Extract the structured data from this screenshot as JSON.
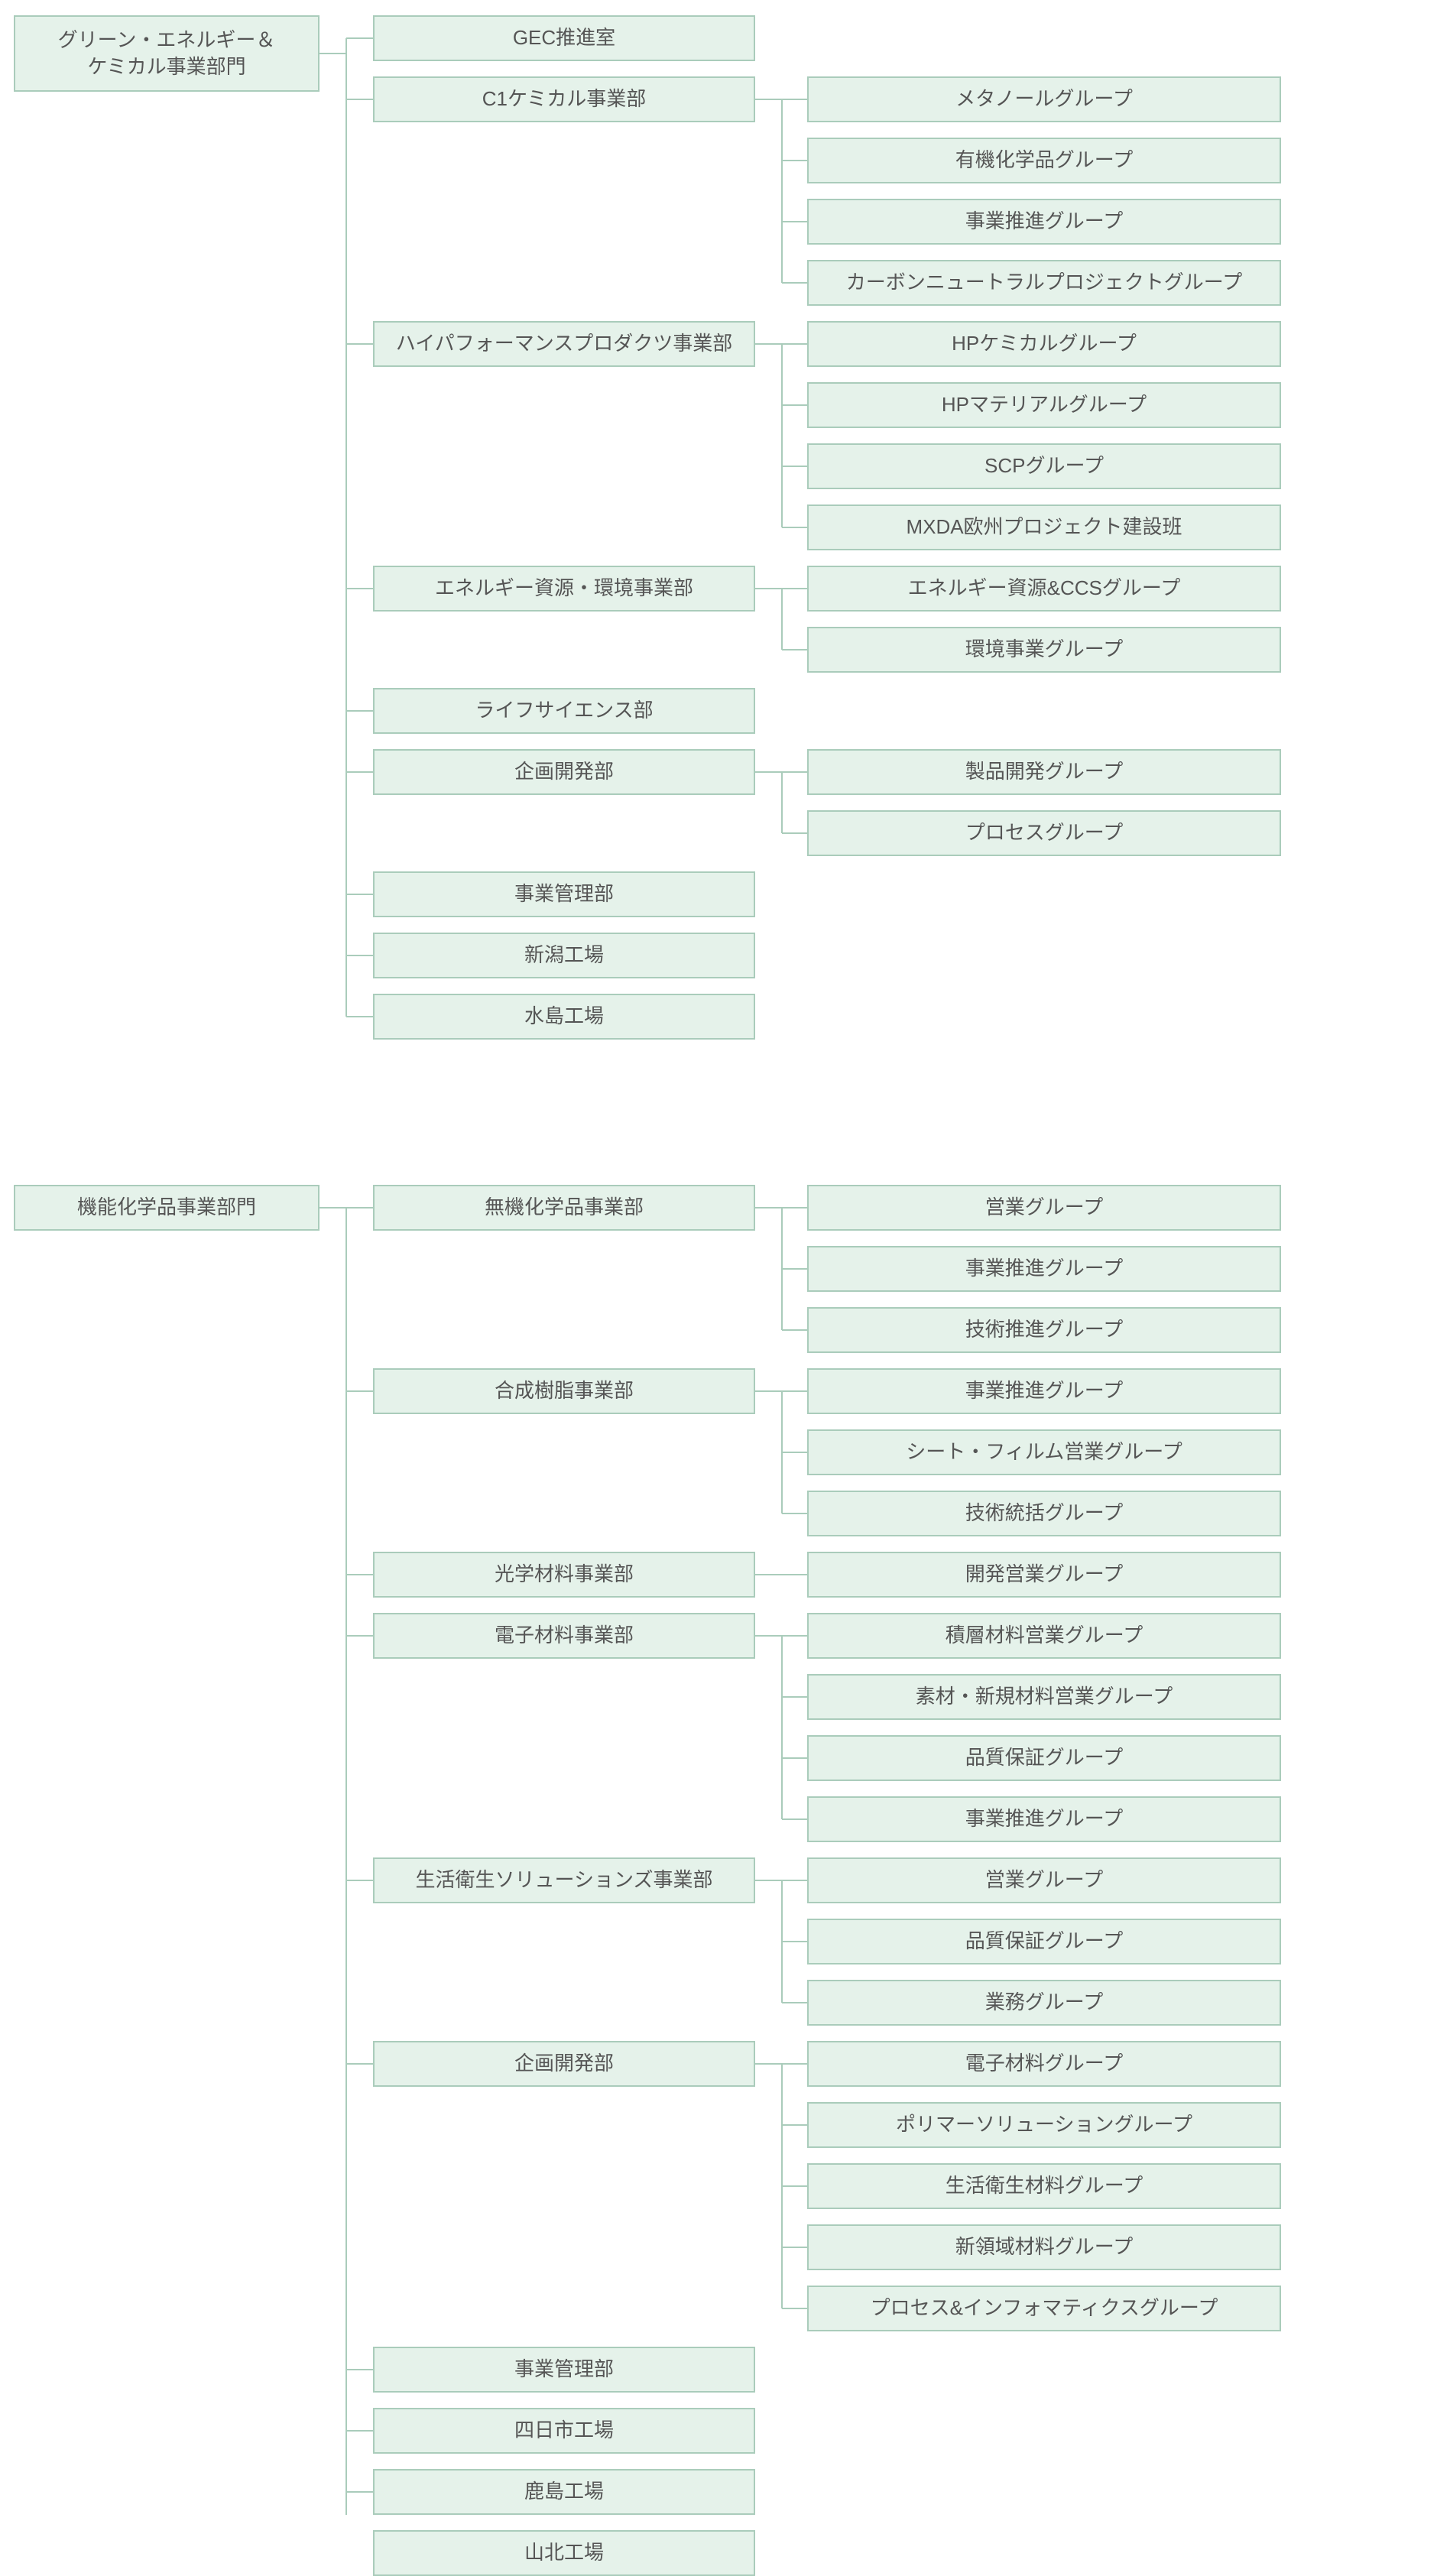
{
  "layout": {
    "rootLeft": 18,
    "rootWidth": 400,
    "rootHeight": 100,
    "rootHeightSingle": 60,
    "deptLeft": 488,
    "deptWidth": 500,
    "deptHeight": 60,
    "groupLeft": 1056,
    "groupWidth": 620,
    "groupHeight": 60,
    "vgap": 20,
    "sectionGap": 190
  },
  "sections": [
    {
      "id": "sector-green-energy-chemical",
      "label": "グリーン・エネルギー＆\nケミカル事業部門",
      "rootTop": 20,
      "rootHeightKey": "rootHeight",
      "departments": [
        {
          "id": "dept-gec-promotion",
          "label": "GEC推進室",
          "groups": []
        },
        {
          "id": "dept-c1-chemical",
          "label": "C1ケミカル事業部",
          "groups": [
            "メタノールグループ",
            "有機化学品グループ",
            "事業推進グループ",
            "カーボンニュートラルプロジェクトグループ"
          ]
        },
        {
          "id": "dept-high-performance-products",
          "label": "ハイパフォーマンスプロダクツ事業部",
          "groups": [
            "HPケミカルグループ",
            "HPマテリアルグループ",
            "SCPグループ",
            "MXDA欧州プロジェクト建設班"
          ]
        },
        {
          "id": "dept-energy-resources-env",
          "label": "エネルギー資源・環境事業部",
          "groups": [
            "エネルギー資源&CCSグループ",
            "環境事業グループ"
          ]
        },
        {
          "id": "dept-life-science",
          "label": "ライフサイエンス部",
          "groups": []
        },
        {
          "id": "dept-planning-dev-1",
          "label": "企画開発部",
          "groups": [
            "製品開発グループ",
            "プロセスグループ"
          ]
        },
        {
          "id": "dept-business-admin-1",
          "label": "事業管理部",
          "groups": []
        },
        {
          "id": "dept-niigata-plant",
          "label": "新潟工場",
          "groups": []
        },
        {
          "id": "dept-mizushima-plant",
          "label": "水島工場",
          "groups": []
        }
      ]
    },
    {
      "id": "sector-functional-chemicals",
      "label": "機能化学品事業部門",
      "rootHeightKey": "rootHeightSingle",
      "departments": [
        {
          "id": "dept-inorganic-chem",
          "label": "無機化学品事業部",
          "groups": [
            "営業グループ",
            "事業推進グループ",
            "技術推進グループ"
          ]
        },
        {
          "id": "dept-synthetic-resin",
          "label": "合成樹脂事業部",
          "groups": [
            "事業推進グループ",
            "シート・フィルム営業グループ",
            "技術統括グループ"
          ]
        },
        {
          "id": "dept-optical-materials",
          "label": "光学材料事業部",
          "groups": [
            "開発営業グループ"
          ]
        },
        {
          "id": "dept-electronic-materials",
          "label": "電子材料事業部",
          "groups": [
            "積層材料営業グループ",
            "素材・新規材料営業グループ",
            "品質保証グループ",
            "事業推進グループ"
          ]
        },
        {
          "id": "dept-hygiene-solutions",
          "label": "生活衛生ソリューションズ事業部",
          "groups": [
            "営業グループ",
            "品質保証グループ",
            "業務グループ"
          ]
        },
        {
          "id": "dept-planning-dev-2",
          "label": "企画開発部",
          "groups": [
            "電子材料グループ",
            "ポリマーソリューショングループ",
            "生活衛生材料グループ",
            "新領域材料グループ",
            "プロセス&インフォマティクスグループ"
          ]
        },
        {
          "id": "dept-business-admin-2",
          "label": "事業管理部",
          "groups": []
        },
        {
          "id": "dept-yokkaichi-plant",
          "label": "四日市工場",
          "groups": []
        },
        {
          "id": "dept-kashima-plant",
          "label": "鹿島工場",
          "groups": []
        },
        {
          "id": "dept-yamakita-plant",
          "label": "山北工場",
          "groups": []
        }
      ]
    }
  ],
  "chart_data": {
    "type": "tree",
    "title": "",
    "nodes": [
      {
        "name": "グリーン・エネルギー＆ケミカル事業部門",
        "children": [
          {
            "name": "GEC推進室"
          },
          {
            "name": "C1ケミカル事業部",
            "children": [
              {
                "name": "メタノールグループ"
              },
              {
                "name": "有機化学品グループ"
              },
              {
                "name": "事業推進グループ"
              },
              {
                "name": "カーボンニュートラルプロジェクトグループ"
              }
            ]
          },
          {
            "name": "ハイパフォーマンスプロダクツ事業部",
            "children": [
              {
                "name": "HPケミカルグループ"
              },
              {
                "name": "HPマテリアルグループ"
              },
              {
                "name": "SCPグループ"
              },
              {
                "name": "MXDA欧州プロジェクト建設班"
              }
            ]
          },
          {
            "name": "エネルギー資源・環境事業部",
            "children": [
              {
                "name": "エネルギー資源&CCSグループ"
              },
              {
                "name": "環境事業グループ"
              }
            ]
          },
          {
            "name": "ライフサイエンス部"
          },
          {
            "name": "企画開発部",
            "children": [
              {
                "name": "製品開発グループ"
              },
              {
                "name": "プロセスグループ"
              }
            ]
          },
          {
            "name": "事業管理部"
          },
          {
            "name": "新潟工場"
          },
          {
            "name": "水島工場"
          }
        ]
      },
      {
        "name": "機能化学品事業部門",
        "children": [
          {
            "name": "無機化学品事業部",
            "children": [
              {
                "name": "営業グループ"
              },
              {
                "name": "事業推進グループ"
              },
              {
                "name": "技術推進グループ"
              }
            ]
          },
          {
            "name": "合成樹脂事業部",
            "children": [
              {
                "name": "事業推進グループ"
              },
              {
                "name": "シート・フィルム営業グループ"
              },
              {
                "name": "技術統括グループ"
              }
            ]
          },
          {
            "name": "光学材料事業部",
            "children": [
              {
                "name": "開発営業グループ"
              }
            ]
          },
          {
            "name": "電子材料事業部",
            "children": [
              {
                "name": "積層材料営業グループ"
              },
              {
                "name": "素材・新規材料営業グループ"
              },
              {
                "name": "品質保証グループ"
              },
              {
                "name": "事業推進グループ"
              }
            ]
          },
          {
            "name": "生活衛生ソリューションズ事業部",
            "children": [
              {
                "name": "営業グループ"
              },
              {
                "name": "品質保証グループ"
              },
              {
                "name": "業務グループ"
              }
            ]
          },
          {
            "name": "企画開発部",
            "children": [
              {
                "name": "電子材料グループ"
              },
              {
                "name": "ポリマーソリューショングループ"
              },
              {
                "name": "生活衛生材料グループ"
              },
              {
                "name": "新領域材料グループ"
              },
              {
                "name": "プロセス&インフォマティクスグループ"
              }
            ]
          },
          {
            "name": "事業管理部"
          },
          {
            "name": "四日市工場"
          },
          {
            "name": "鹿島工場"
          },
          {
            "name": "山北工場"
          }
        ]
      }
    ]
  }
}
